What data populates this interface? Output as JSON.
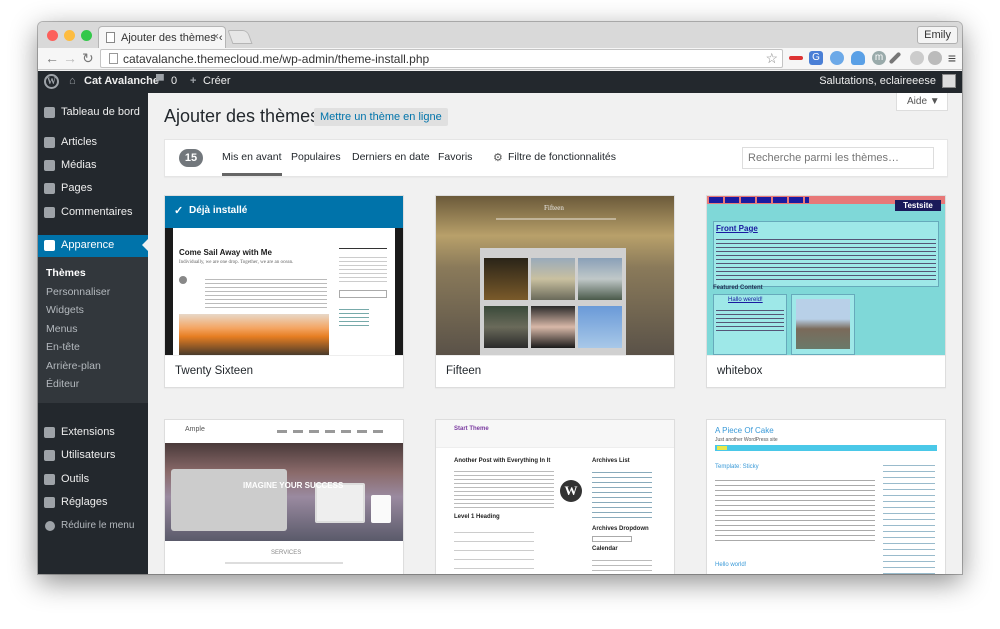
{
  "browser": {
    "tab_title": "Ajouter des thèmes ‹ Cat Av",
    "tab_close": "×",
    "user_name": "Emily",
    "url": "catavalanche.themecloud.me/wp-admin/theme-install.php",
    "colors": {
      "close": "#fc605c",
      "minimize": "#fdbc40",
      "zoom": "#34c84a"
    }
  },
  "adminbar": {
    "logo": "W",
    "site_name": "Cat Avalanche",
    "comments_count": "0",
    "new_label": "Créer",
    "greeting": "Salutations, eclaireeese"
  },
  "sidebar": {
    "items": [
      {
        "label": "Tableau de bord",
        "icon": "dashboard-icon"
      },
      {
        "label": "Articles",
        "icon": "pin-icon"
      },
      {
        "label": "Médias",
        "icon": "media-icon"
      },
      {
        "label": "Pages",
        "icon": "pages-icon"
      },
      {
        "label": "Commentaires",
        "icon": "comments-icon"
      },
      {
        "label": "Apparence",
        "icon": "brush-icon"
      },
      {
        "label": "Extensions",
        "icon": "plugin-icon"
      },
      {
        "label": "Utilisateurs",
        "icon": "users-icon"
      },
      {
        "label": "Outils",
        "icon": "tools-icon"
      },
      {
        "label": "Réglages",
        "icon": "settings-icon"
      }
    ],
    "submenu": [
      "Thèmes",
      "Personnaliser",
      "Widgets",
      "Menus",
      "En-tête",
      "Arrière-plan",
      "Éditeur"
    ],
    "collapse": "Réduire le menu"
  },
  "content": {
    "title": "Ajouter des thèmes",
    "upload_label": "Mettre un thème en ligne",
    "help_label": "Aide ▼",
    "count": "15",
    "filters": [
      "Mis en avant",
      "Populaires",
      "Derniers en date",
      "Favoris",
      "Filtre de fonctionnalités"
    ],
    "search_placeholder": "Recherche parmi les thèmes…"
  },
  "themes": [
    {
      "name": "Twenty Sixteen",
      "installed": "Déjà installé",
      "preview_title": "Come Sail Away with Me",
      "preview_subtitle": "Individually, we are one drop. Together, we are an ocean."
    },
    {
      "name": "Fifteen",
      "preview_title": "Fifteen"
    },
    {
      "name": "whitebox",
      "preview_site": "Testsite",
      "preview_heading": "Front Page",
      "preview_section": "Featured Content",
      "preview_hello": "Hallo wereld!"
    },
    {
      "name": "",
      "preview_title": "Ample",
      "preview_banner": "IMAGINE YOUR SUCCESS",
      "preview_services": "SERVICES"
    },
    {
      "name": "",
      "preview_title": "Start Theme",
      "preview_post": "Another Post with Everything In It",
      "preview_archives": "Archives List",
      "preview_level": "Level 1 Heading",
      "preview_dropdown": "Archives Dropdown",
      "preview_calendar": "Calendar"
    },
    {
      "name": "",
      "preview_title": "A Piece Of Cake",
      "preview_subtitle": "Just another WordPress site",
      "preview_post": "Template: Sticky",
      "preview_post2": "Hello world!"
    }
  ]
}
